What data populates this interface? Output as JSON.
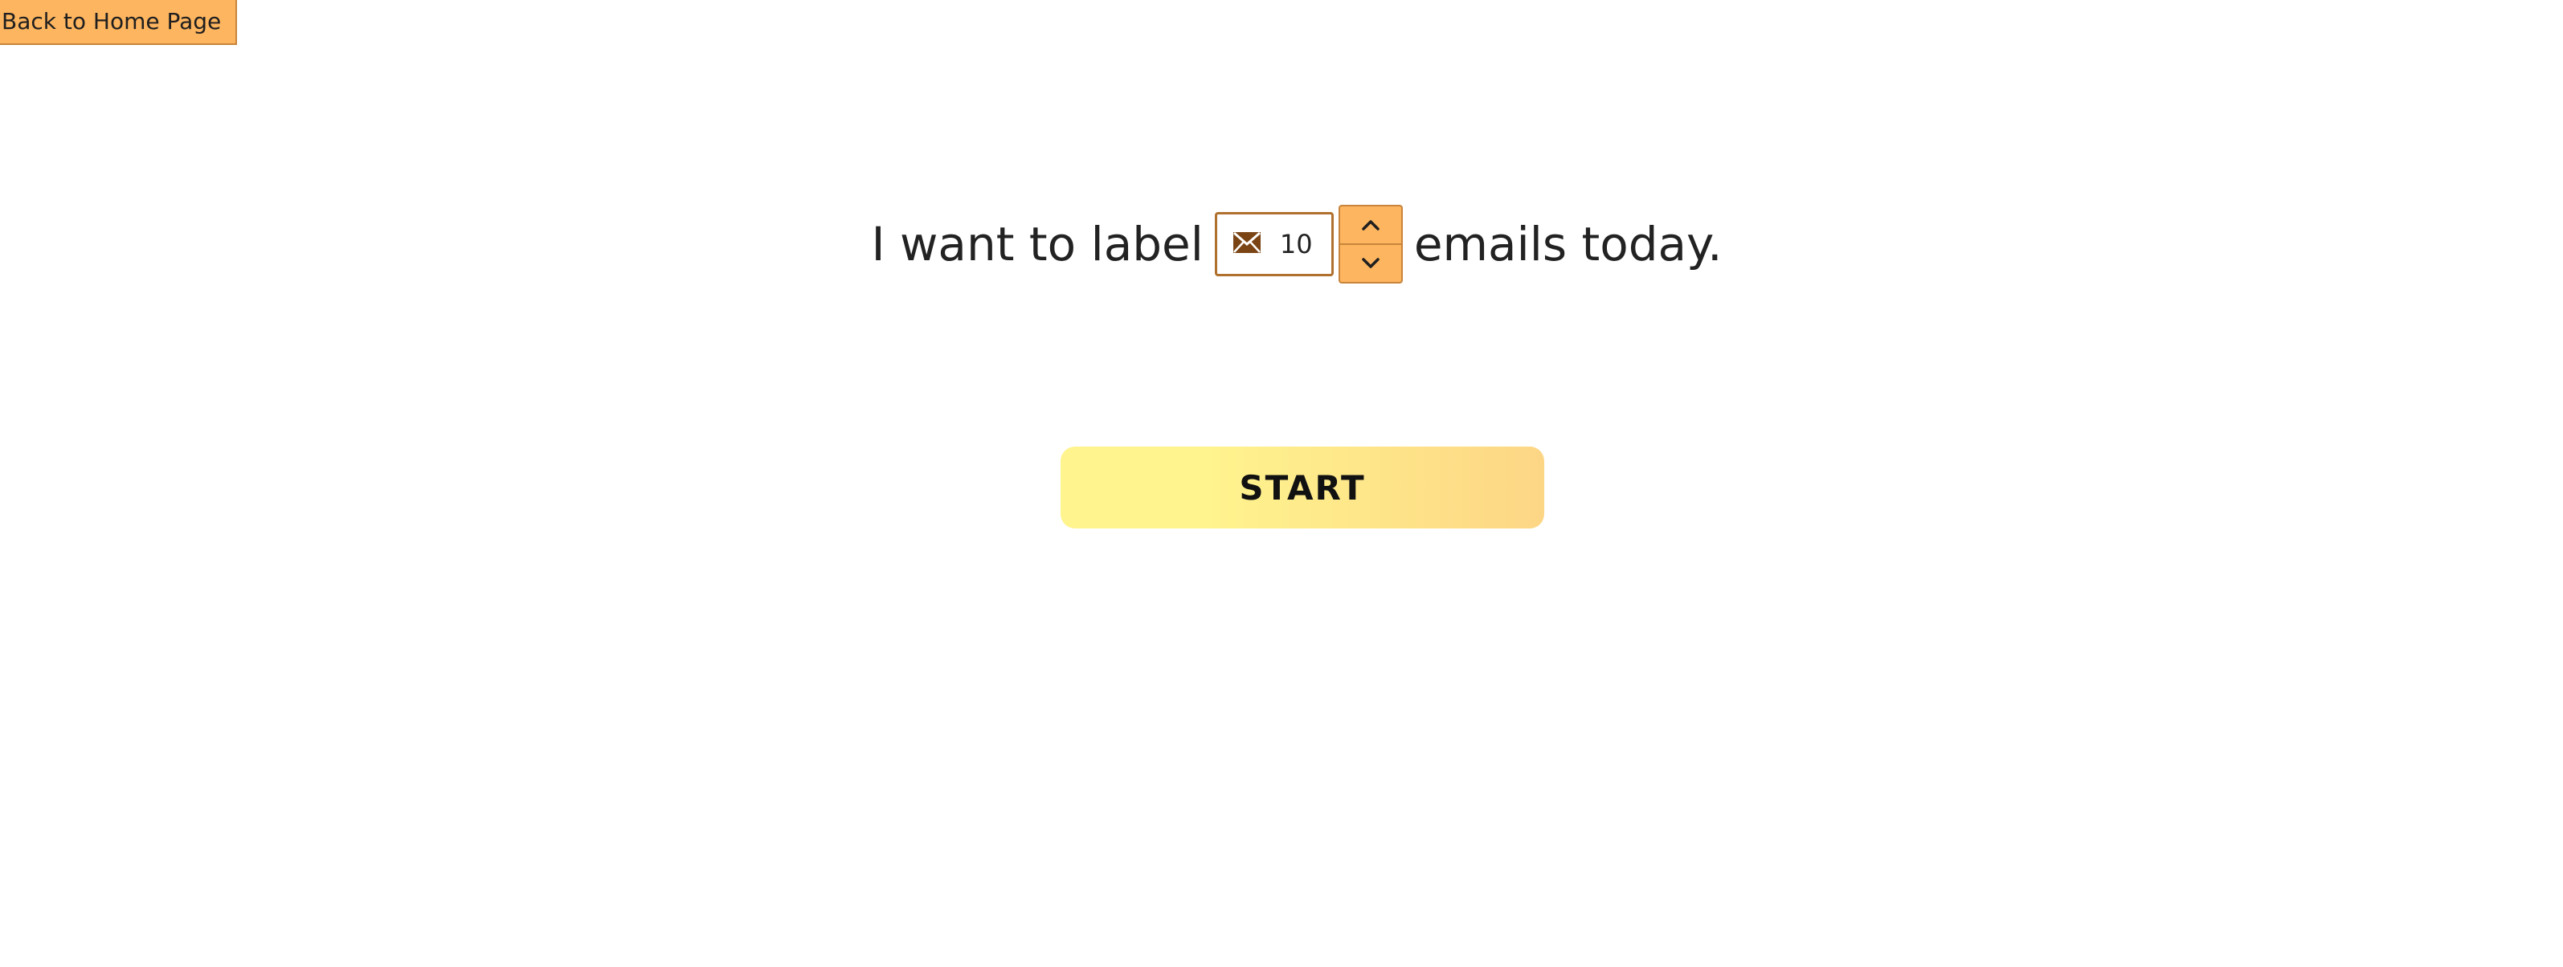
{
  "nav": {
    "back_label": "Back to Home Page"
  },
  "prompt": {
    "prefix": "I want to label",
    "count_value": "10",
    "count_icon": "envelope-icon",
    "suffix": "emails today."
  },
  "stepper": {
    "up_icon": "chevron-up-icon",
    "down_icon": "chevron-down-icon"
  },
  "actions": {
    "start_label": "START"
  },
  "colors": {
    "accent": "#fdb55f",
    "accent_border": "#c8843a",
    "start_gradient_left": "#fff48e",
    "start_gradient_right": "#fdd685",
    "envelope": "#7a4414"
  }
}
